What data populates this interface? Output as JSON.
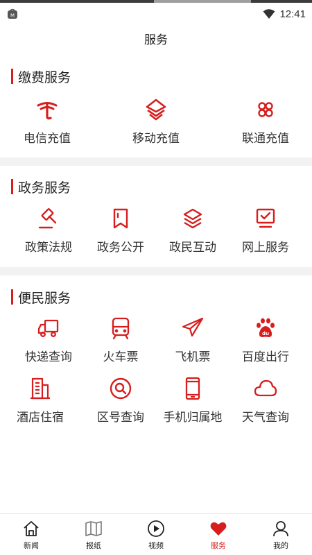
{
  "status": {
    "time": "12:41"
  },
  "page": {
    "title": "服务"
  },
  "sections": [
    {
      "title": "缴费服务",
      "items": [
        {
          "label": "电信充值",
          "icon": "china-telecom-icon"
        },
        {
          "label": "移动充值",
          "icon": "china-mobile-icon"
        },
        {
          "label": "联通充值",
          "icon": "china-unicom-icon"
        }
      ]
    },
    {
      "title": "政务服务",
      "items": [
        {
          "label": "政策法规",
          "icon": "gavel-icon"
        },
        {
          "label": "政务公开",
          "icon": "bookmark-icon"
        },
        {
          "label": "政民互动",
          "icon": "layers-icon"
        },
        {
          "label": "网上服务",
          "icon": "monitor-check-icon"
        }
      ]
    },
    {
      "title": "便民服务",
      "items": [
        {
          "label": "快递查询",
          "icon": "truck-icon"
        },
        {
          "label": "火车票",
          "icon": "train-icon"
        },
        {
          "label": "飞机票",
          "icon": "airplane-icon"
        },
        {
          "label": "百度出行",
          "icon": "baidu-icon"
        },
        {
          "label": "酒店住宿",
          "icon": "hotel-building-icon"
        },
        {
          "label": "区号查询",
          "icon": "search-circle-icon"
        },
        {
          "label": "手机归属地",
          "icon": "mobile-phone-icon"
        },
        {
          "label": "天气查询",
          "icon": "cloud-icon"
        }
      ]
    }
  ],
  "nav": [
    {
      "label": "新闻",
      "icon": "home-icon",
      "active": false
    },
    {
      "label": "报纸",
      "icon": "newspaper-map-icon",
      "active": false
    },
    {
      "label": "视频",
      "icon": "play-circle-icon",
      "active": false
    },
    {
      "label": "服务",
      "icon": "heart-icon",
      "active": true
    },
    {
      "label": "我的",
      "icon": "user-icon",
      "active": false
    }
  ],
  "colors": {
    "accent": "#d71d1d",
    "divider": "#f2f2f2"
  }
}
